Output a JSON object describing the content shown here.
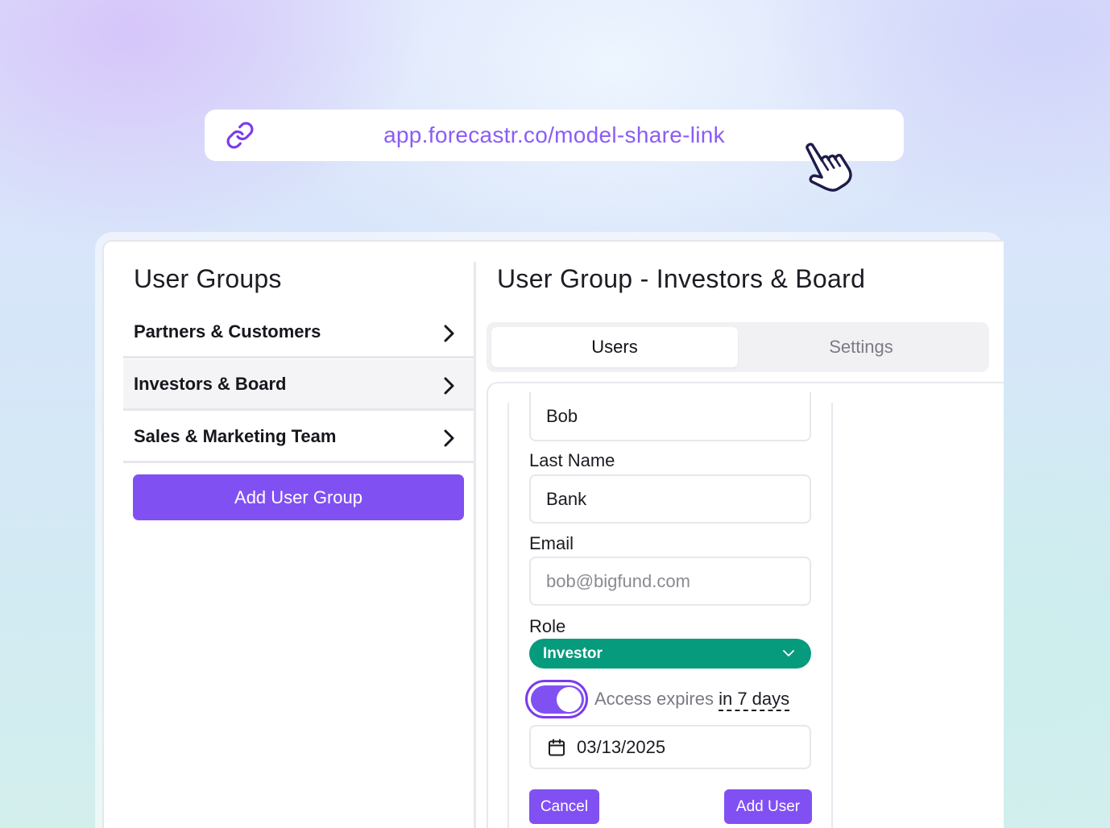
{
  "share_link": {
    "url": "app.forecastr.co/model-share-link",
    "icon": "link-icon",
    "cursor_icon": "hand-pointer-icon"
  },
  "sidebar": {
    "title": "User Groups",
    "items": [
      {
        "label": "Partners & Customers",
        "selected": false
      },
      {
        "label": "Investors & Board",
        "selected": true
      },
      {
        "label": "Sales & Marketing Team",
        "selected": false
      }
    ],
    "add_button_label": "Add User Group"
  },
  "main": {
    "title": "User Group - Investors & Board",
    "tabs": [
      {
        "label": "Users",
        "active": true
      },
      {
        "label": "Settings",
        "active": false
      }
    ],
    "form": {
      "first_name_value": "Bob",
      "last_name_label": "Last Name",
      "last_name_value": "Bank",
      "email_label": "Email",
      "email_placeholder": "bob@bigfund.com",
      "role_label": "Role",
      "role_value": "Investor",
      "access_toggle_on": true,
      "access_text": "Access expires",
      "access_link": "in 7 days",
      "expiry_date": "03/13/2025",
      "cancel_label": "Cancel",
      "add_user_label": "Add User"
    }
  },
  "colors": {
    "accent": "#8150f3",
    "link_text": "#8b5cf6",
    "role_badge": "#079b7e"
  }
}
